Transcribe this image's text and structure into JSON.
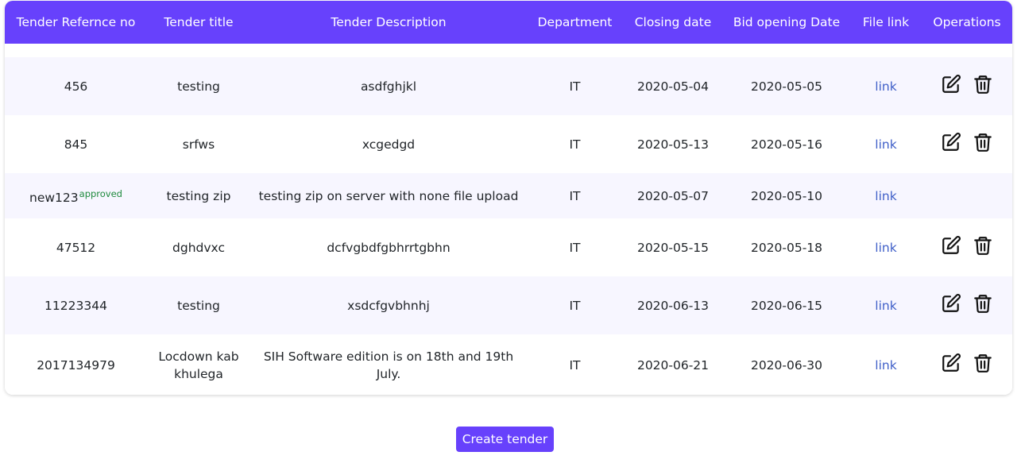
{
  "table": {
    "headers": [
      "Tender Refernce no",
      "Tender title",
      "Tender Description",
      "Department",
      "Closing date",
      "Bid opening Date",
      "File link",
      "Operations"
    ],
    "rows": [
      {
        "ref": "456",
        "badge": "",
        "title": "testing",
        "description": "asdfghjkl",
        "department": "IT",
        "closing": "2020-05-04",
        "opening": "2020-05-05",
        "link": "link",
        "operations": true
      },
      {
        "ref": "845",
        "badge": "",
        "title": "srfws",
        "description": "xcgedgd",
        "department": "IT",
        "closing": "2020-05-13",
        "opening": "2020-05-16",
        "link": "link",
        "operations": true
      },
      {
        "ref": "new123",
        "badge": "approved",
        "title": "testing zip",
        "description": "testing zip on server with none file upload",
        "department": "IT",
        "closing": "2020-05-07",
        "opening": "2020-05-10",
        "link": "link",
        "operations": false
      },
      {
        "ref": "47512",
        "badge": "",
        "title": "dghdvxc",
        "description": "dcfvgbdfgbhrrtgbhn",
        "department": "IT",
        "closing": "2020-05-15",
        "opening": "2020-05-18",
        "link": "link",
        "operations": true
      },
      {
        "ref": "11223344",
        "badge": "",
        "title": "testing",
        "description": "xsdcfgvbhnhj",
        "department": "IT",
        "closing": "2020-06-13",
        "opening": "2020-06-15",
        "link": "link",
        "operations": true
      },
      {
        "ref": "2017134979",
        "badge": "",
        "title": "Locdown kab khulega",
        "description": "SIH Software edition is on 18th and 19th July.",
        "department": "IT",
        "closing": "2020-06-21",
        "opening": "2020-06-30",
        "link": "link",
        "operations": true
      }
    ]
  },
  "actions": {
    "create_label": "Create tender"
  },
  "icons": {
    "edit": "edit-icon",
    "delete": "trash-icon"
  },
  "colors": {
    "accent": "#6741fc",
    "badge": "#1e8a3d",
    "link": "#3f5fc8",
    "row_alt": "#f7f6ff"
  }
}
